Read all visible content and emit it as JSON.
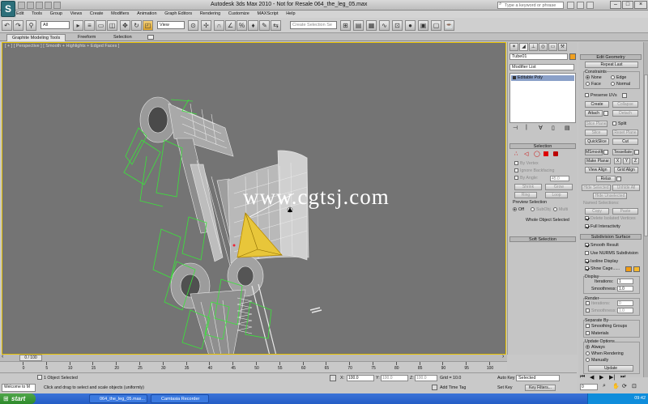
{
  "title_bar": {
    "title": "Autodesk 3ds Max  2010   -  Not for Resale    064_the_leg_05.max",
    "search_placeholder": "Type a keyword or phrase"
  },
  "app_icon_letter": "S",
  "menu": [
    "Edit",
    "Tools",
    "Group",
    "Views",
    "Create",
    "Modifiers",
    "Animation",
    "Graph Editors",
    "Rendering",
    "Customize",
    "MAXScript",
    "Help"
  ],
  "toolbar": {
    "selection_filter": "All",
    "reference_coord": "View",
    "named_selection_placeholder": "Create Selection Se"
  },
  "ribbon_tabs": [
    "Graphite Modeling Tools",
    "Freeform",
    "Selection"
  ],
  "viewport": {
    "label": "[ + ] [ Perspective ] [ Smooth + Highlights + Edged Faces ]",
    "watermark": "www.cgtsj.com",
    "border_color": "#e6c000",
    "wire_color": "#39e639"
  },
  "command_panel": {
    "object_name": "Tube01",
    "modifier_list": "Modifier List",
    "stack_item": "Editable Poly",
    "selection": {
      "header": "Selection",
      "by_vertex": "By Vertex",
      "ignore_backfacing": "Ignore Backfacing",
      "by_angle": "By Angle:",
      "angle_value": "45.0",
      "shrink": "Shrink",
      "grow": "Grow",
      "ring": "Ring",
      "loop": "Loop",
      "preview_header": "Preview Selection",
      "preview_off": "Off",
      "preview_subobj": "SubObj",
      "preview_multi": "Multi",
      "whole_object": "Whole Object Selected"
    },
    "soft_selection": "Soft Selection"
  },
  "edit_geometry": {
    "header": "Edit Geometry",
    "repeat_last": "Repeat Last",
    "constraints_header": "Constraints",
    "none": "None",
    "edge": "Edge",
    "face": "Face",
    "normal": "Normal",
    "preserve_uvs": "Preserve UVs",
    "create": "Create",
    "collapse": "Collapse",
    "attach": "Attach",
    "detach": "Detach",
    "slice_plane": "Slice Plane",
    "split": "Split",
    "slice": "Slice",
    "reset_plane": "Reset Plane",
    "quickslice": "QuickSlice",
    "cut": "Cut",
    "msmooth": "MSmooth",
    "tessellate": "Tessellate",
    "make_planar": "Make Planar",
    "x": "X",
    "y": "Y",
    "z": "Z",
    "view_align": "View Align",
    "grid_align": "Grid Align",
    "relax": "Relax",
    "hide_selected": "Hide Selected",
    "unhide_all": "Unhide All",
    "hide_unselected": "Hide Unselected",
    "named_selections": "Named Selections:",
    "copy": "Copy",
    "paste": "Paste",
    "delete_isolated": "Delete Isolated Vertices",
    "full_interactivity": "Full Interactivity"
  },
  "subdivision": {
    "header": "Subdivision Surface",
    "smooth_result": "Smooth Result",
    "use_nurms": "Use NURMS Subdivision",
    "isoline": "Isoline Display",
    "show_cage": "Show Cage......",
    "display_header": "Display",
    "iterations_label": "Iterations:",
    "display_iterations": "1",
    "smoothness_label": "Smoothness:",
    "display_smoothness": "1.0",
    "render_header": "Render",
    "render_iterations": "0",
    "render_smoothness": "1.0",
    "separate_header": "Separate By",
    "smoothing_groups": "Smoothing Groups",
    "materials": "Materials",
    "update_header": "Update Options",
    "always": "Always",
    "when_rendering": "When Rendering",
    "manually": "Manually",
    "update": "Update",
    "cage_color1": "#f39c12",
    "cage_color2": "#f5b82e"
  },
  "timeline": {
    "frame_label": "0 / 100",
    "ticks": [
      "0",
      "5",
      "10",
      "15",
      "20",
      "25",
      "30",
      "35",
      "40",
      "45",
      "50",
      "55",
      "60",
      "65",
      "70",
      "75",
      "80",
      "85",
      "90",
      "95",
      "100"
    ]
  },
  "status": {
    "welcome": "Welcome to M",
    "selected": "1 Object Selected",
    "prompt": "Click and drag to select and scale objects (uniformly)",
    "x_value": "100.0",
    "y_value": "100.0",
    "z_value": "100.0",
    "grid": "Grid = 10.0",
    "add_time_tag": "Add Time Tag",
    "auto_key": "Auto Key",
    "set_key": "Set Key",
    "key_mode": "Selected",
    "key_filters": "Key Filters...",
    "frame": "0"
  },
  "taskbar": {
    "start": "start",
    "tasks": [
      "064_the_leg_05.max...",
      "Camtasia Recorder"
    ],
    "clock": "09:42"
  }
}
